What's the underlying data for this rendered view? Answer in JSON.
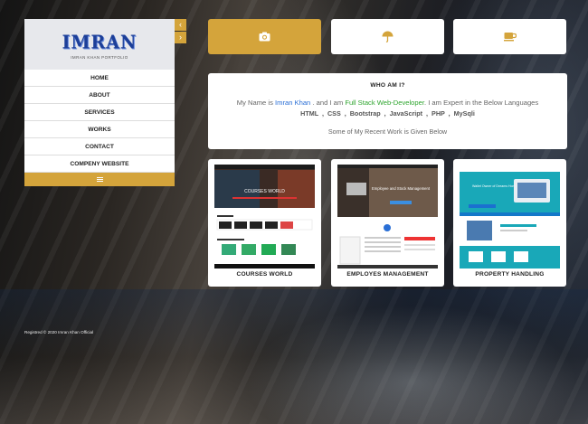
{
  "sidebar": {
    "logo": "IMRAN",
    "tagline": "IMRAN KHAN PORTFOLIO",
    "menu": [
      "HOME",
      "ABOUT",
      "SERVICES",
      "WORKS",
      "CONTACT",
      "COMPENY WEBSITE"
    ],
    "collapse_icon": "chevron-left-icon",
    "expand_icon": "chevron-right-icon",
    "menu_toggle_icon": "hamburger-icon"
  },
  "top_buttons": [
    {
      "icon": "camera-icon",
      "active": true
    },
    {
      "icon": "umbrella-icon",
      "active": false
    },
    {
      "icon": "coffee-cup-icon",
      "active": false
    }
  ],
  "about": {
    "title": "WHO AM I?",
    "prefix": "My Name is",
    "name": "Imran Khan",
    "mid": ". and I am",
    "role": "Full Stack Web-Developer",
    "suffix": ". I am Expert in the Below Languages",
    "languages": "HTML , CSS , Bootstrap , JavaScript , PHP , MySqli",
    "recent": "Some of My Recent Work is Given Below"
  },
  "works": [
    {
      "title": "COURSES WORLD",
      "thumb_heading": "COURSES WORLD"
    },
    {
      "title": "EMPLOYES MANAGEMENT",
      "thumb_heading": "Employee and Stock Management"
    },
    {
      "title": "PROPERTY HANDLING",
      "thumb_heading": "Wallet Owner of Dreams Home"
    }
  ],
  "footer": "Registred © 2020 Imran Khan Official",
  "colors": {
    "accent": "#d4a43b",
    "blue": "#2a6fd6",
    "green": "#2ea52e",
    "logo": "#1d3f99"
  }
}
